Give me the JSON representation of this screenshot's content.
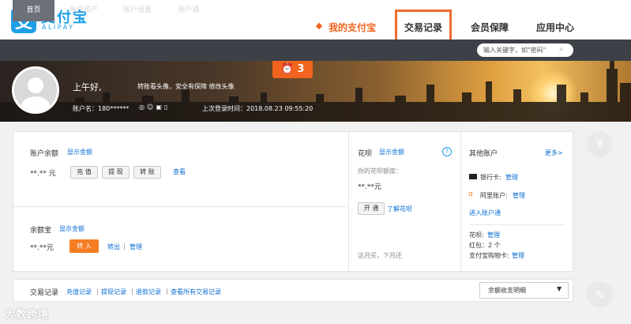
{
  "brand": {
    "logo_glyph": "支",
    "name_cn": "支付宝",
    "name_en": "ALIPAY",
    "color": "#1d9ee8"
  },
  "top_nav": {
    "items": [
      "我的支付宝",
      "交易记录",
      "会员保障",
      "应用中心"
    ],
    "active_index": 0,
    "active_color": "#f0641e",
    "highlight_color": "#ee6c2e"
  },
  "sub_nav": {
    "items": [
      "首页",
      "账户资产",
      "账户设置",
      "账户通"
    ],
    "active_index": 0
  },
  "search": {
    "placeholder": "输入关键字，如\"密码\"",
    "icon": "search-icon"
  },
  "banner": {
    "alarm_icon": "alarm-clock-icon",
    "alarm_count": "3",
    "greeting": "上午好,",
    "greeting_tip": "转账看头像，安全有保障 修改头像",
    "account_label": "账户名：180******",
    "last_login": "上次登录时间：2018.08.23 09:55:20"
  },
  "balance": {
    "title": "账户余额",
    "show_link": "显示金额",
    "value": "**.** 元",
    "buttons": [
      "充 值",
      "提 现",
      "转 账"
    ],
    "view_link": "查看"
  },
  "yuebao": {
    "title": "余额宝",
    "show_link": "显示金额",
    "value": "**.**元",
    "in_button": "转 入",
    "out_link": "转出",
    "sep": "|",
    "manage_link": "管理"
  },
  "huabei": {
    "title": "花呗",
    "show_link": "显示金额",
    "help": "?",
    "quota_label": "你的花呗额度：",
    "quota_value": "**.**元",
    "open_button": "开 通",
    "learn_link": "了解花呗",
    "footer": "这月买，下月还"
  },
  "other_accounts": {
    "title": "其他账户",
    "more_link": "更多>",
    "bank_label": "银行卡:",
    "bank_manage": "管理",
    "ali_label": "阿里账户:",
    "ali_manage": "管理",
    "enter_link": "进入账户通",
    "huabei_label": "花呗:",
    "huabei_manage": "管理",
    "hongbao": "红包：2 个",
    "gift_label": "支付宝购物卡:",
    "gift_manage": "管理"
  },
  "records": {
    "title": "交易记录",
    "links": [
      "充值记录",
      "提现记录",
      "退款记录",
      "查看所有交易记录"
    ],
    "select_value": "余额收支明细"
  },
  "floaters": {
    "yen": "¥",
    "chart": "∿"
  },
  "watermark": "大数跨境"
}
